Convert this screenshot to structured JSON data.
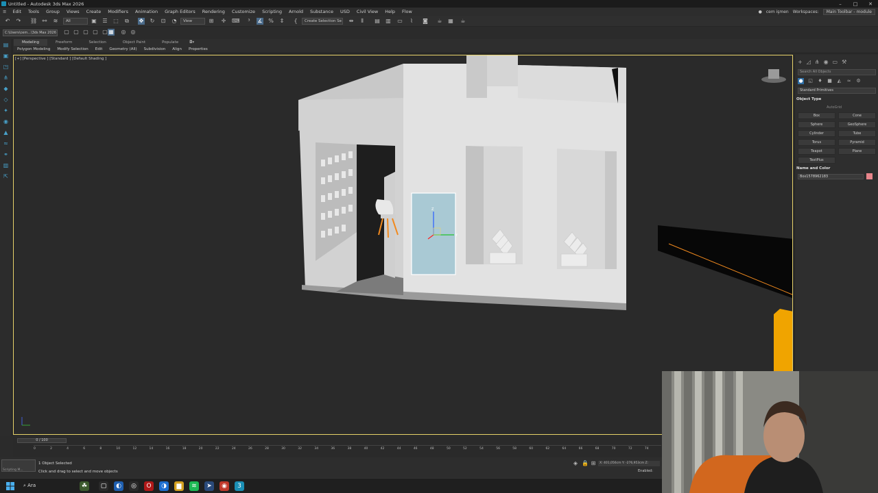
{
  "window": {
    "title": "Untitled - Autodesk 3ds Max 2026"
  },
  "menubar": {
    "items": [
      "Edit",
      "Tools",
      "Group",
      "Views",
      "Create",
      "Modifiers",
      "Animation",
      "Graph Editors",
      "Rendering",
      "Customize",
      "Scripting",
      "Arnold",
      "Substance",
      "USD",
      "Civil View",
      "Help",
      "Flow"
    ],
    "user": "cem işmen",
    "workspaces_label": "Workspaces:",
    "workspace_value": "Main Toolbar - module"
  },
  "toolbar": {
    "filter_value": "All",
    "view_value": "View",
    "selection_set_placeholder": "Create Selection Se"
  },
  "toolbar2": {
    "path": "C:\\Users\\cem...\\3ds Max 2026"
  },
  "ribbon": {
    "tabs": [
      "Modeling",
      "Freeform",
      "Selection",
      "Object Paint",
      "Populate"
    ],
    "items": [
      "Polygon Modeling",
      "Modify Selection",
      "Edit",
      "Geometry (All)",
      "Subdivision",
      "Align",
      "Properties"
    ]
  },
  "viewport": {
    "label": "[+] [Perspective ] [Standard ] [Default Shading ]"
  },
  "command_panel": {
    "search_placeholder": "Search All Objects",
    "category": "Standard Primitives",
    "object_type_title": "Object Type",
    "autogrid": "AutoGrid",
    "primitives": [
      "Box",
      "Cone",
      "Sphere",
      "GeoSphere",
      "Cylinder",
      "Tube",
      "Torus",
      "Pyramid",
      "Teapot",
      "Plane",
      "TextPlus"
    ],
    "name_color_title": "Name and Color",
    "object_name": "Box1578962183",
    "object_color": "#e8858b"
  },
  "timeline": {
    "slider": "0 / 100",
    "ticks": [
      "0",
      "2",
      "4",
      "6",
      "8",
      "10",
      "12",
      "14",
      "16",
      "18",
      "20",
      "22",
      "24",
      "26",
      "28",
      "30",
      "32",
      "34",
      "36",
      "38",
      "40",
      "42",
      "44",
      "46",
      "48",
      "50",
      "52",
      "54",
      "56",
      "58",
      "60",
      "62",
      "64",
      "66",
      "68",
      "70",
      "72",
      "74"
    ]
  },
  "status": {
    "script_label": "Scripting M...",
    "line1": "1 Object Selected",
    "line2": "Click and drag to select and move objects",
    "coords": "X: 401,056cm  Y: -276,953cm  Z:",
    "enabled": "Enabled:"
  },
  "taskbar": {
    "search": "Ara"
  },
  "colors": {
    "accent": "#2e6da4",
    "selection_fill": "#a9c9d4",
    "orange": "#f28a1e"
  }
}
